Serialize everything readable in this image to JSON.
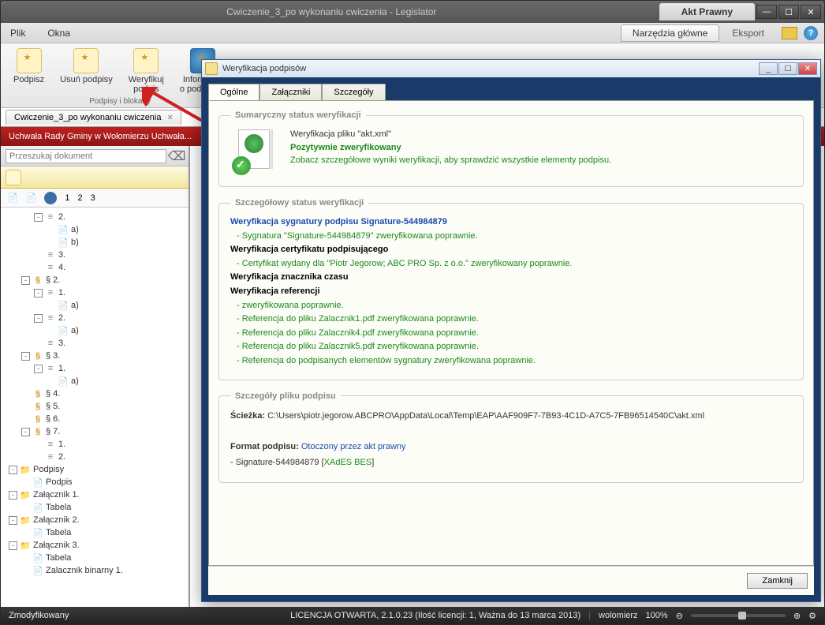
{
  "window": {
    "title_faded": "Cwiczenie_3_po wykonaniu cwiczenia - Legislator",
    "header_tab": "Akt Prawny"
  },
  "menubar": {
    "file": "Plik",
    "windows": "Okna",
    "tab_main": "Narzędzia główne",
    "tab_export": "Eksport"
  },
  "ribbon": {
    "sign": "Podpisz",
    "remove_sigs": "Usuń podpisy",
    "verify_sig_l1": "Weryfikuj",
    "verify_sig_l2": "podpis",
    "sig_info_l1": "Informacja",
    "sig_info_l2": "o podpisach",
    "group_label": "Podpisy i blokady"
  },
  "doc_tab": {
    "label": "Cwiczenie_3_po wykonaniu cwiczenia"
  },
  "red_bar": "Uchwała Rady Gminy w Wołomierzu Uchwała...",
  "search": {
    "placeholder": "Przeszukaj dokument"
  },
  "nav": {
    "n1": "1",
    "n2": "2",
    "n3": "3"
  },
  "tree": [
    {
      "indent": 2,
      "toggle": "-",
      "icon": "num",
      "label": "2."
    },
    {
      "indent": 3,
      "toggle": "",
      "icon": "file",
      "label": "a)"
    },
    {
      "indent": 3,
      "toggle": "",
      "icon": "file",
      "label": "b)"
    },
    {
      "indent": 2,
      "toggle": "",
      "icon": "num",
      "label": "3."
    },
    {
      "indent": 2,
      "toggle": "",
      "icon": "num",
      "label": "4."
    },
    {
      "indent": 1,
      "toggle": "-",
      "icon": "para",
      "label": "§ 2."
    },
    {
      "indent": 2,
      "toggle": "-",
      "icon": "num",
      "label": "1."
    },
    {
      "indent": 3,
      "toggle": "",
      "icon": "file",
      "label": "a)"
    },
    {
      "indent": 2,
      "toggle": "-",
      "icon": "num",
      "label": "2."
    },
    {
      "indent": 3,
      "toggle": "",
      "icon": "file",
      "label": "a)"
    },
    {
      "indent": 2,
      "toggle": "",
      "icon": "num",
      "label": "3."
    },
    {
      "indent": 1,
      "toggle": "-",
      "icon": "para",
      "label": "§ 3."
    },
    {
      "indent": 2,
      "toggle": "-",
      "icon": "num",
      "label": "1."
    },
    {
      "indent": 3,
      "toggle": "",
      "icon": "file",
      "label": "a)"
    },
    {
      "indent": 1,
      "toggle": "",
      "icon": "para",
      "label": "§ 4."
    },
    {
      "indent": 1,
      "toggle": "",
      "icon": "para",
      "label": "§ 5."
    },
    {
      "indent": 1,
      "toggle": "",
      "icon": "para",
      "label": "§ 6."
    },
    {
      "indent": 1,
      "toggle": "-",
      "icon": "para",
      "label": "§ 7."
    },
    {
      "indent": 2,
      "toggle": "",
      "icon": "num",
      "label": "1."
    },
    {
      "indent": 2,
      "toggle": "",
      "icon": "num",
      "label": "2."
    },
    {
      "indent": 0,
      "toggle": "-",
      "icon": "folder",
      "label": "Podpisy"
    },
    {
      "indent": 1,
      "toggle": "",
      "icon": "file",
      "label": "Podpis"
    },
    {
      "indent": 0,
      "toggle": "-",
      "icon": "folder",
      "label": "Załącznik 1."
    },
    {
      "indent": 1,
      "toggle": "",
      "icon": "file",
      "label": "Tabela"
    },
    {
      "indent": 0,
      "toggle": "-",
      "icon": "folder",
      "label": "Załącznik 2."
    },
    {
      "indent": 1,
      "toggle": "",
      "icon": "file",
      "label": "Tabela"
    },
    {
      "indent": 0,
      "toggle": "-",
      "icon": "folder",
      "label": "Załącznik 3."
    },
    {
      "indent": 1,
      "toggle": "",
      "icon": "file",
      "label": "Tabela"
    },
    {
      "indent": 1,
      "toggle": "",
      "icon": "file",
      "label": "Zalacznik binarny 1."
    }
  ],
  "dialog": {
    "title": "Weryfikacja podpisów",
    "tabs": {
      "general": "Ogólne",
      "attachments": "Załączniki",
      "details": "Szczegóły"
    },
    "summary": {
      "legend": "Sumaryczny status weryfikacji",
      "line1": "Weryfikacja pliku \"akt.xml\"",
      "line2": "Pozytywnie zweryfikowany",
      "line3": "Zobacz szczegółowe wyniki weryfikacji, aby sprawdzić wszystkie elementy podpisu."
    },
    "detailed": {
      "legend": "Szczegółowy status weryfikacji",
      "sig_hdr": "Weryfikacja sygnatury podpisu Signature-544984879",
      "sig_ok": "- Sygnatura \"Signature-544984879\" zweryfikowana poprawnie.",
      "cert_hdr": "Weryfikacja certyfikatu podpisującego",
      "cert_ok": "- Certyfikat wydany dla \"Piotr Jegorow; ABC PRO Sp. z o.o.\" zweryfikowany poprawnie.",
      "ts_hdr": "Weryfikacja znacznika czasu",
      "ref_hdr": "Weryfikacja referencji",
      "ref_ok1": " -  zweryfikowana poprawnie.",
      "ref_ok2": " - Referencja do pliku Zalacznik1.pdf zweryfikowana poprawnie.",
      "ref_ok3": " - Referencja do pliku Zalacznik4.pdf zweryfikowana poprawnie.",
      "ref_ok4": " - Referencja do pliku Zalacznik5.pdf zweryfikowana poprawnie.",
      "ref_ok5": " - Referencja do podpisanych elementów sygnatury zweryfikowana poprawnie."
    },
    "file": {
      "legend": "Szczegóły pliku podpisu",
      "path_label": "Ścieżka:",
      "path": "C:\\Users\\piotr.jegorow.ABCPRO\\AppData\\Local\\Temp\\EAP\\AAF909F7-7B93-4C1D-A7C5-7FB96514540C\\akt.xml",
      "format_label": "Format podpisu:",
      "format_value": "Otoczony przez akt prawny",
      "sig_line": " - Signature-544984879 [",
      "sig_type": "XAdES BES",
      "sig_line_end": "]"
    },
    "close_btn": "Zamknij"
  },
  "status": {
    "modified": "Zmodyfikowany",
    "license": "LICENCJA OTWARTA, 2.1.0.23 (Ilość licencji: 1, Ważna do 13 marca 2013)",
    "user": "wolomierz",
    "zoom": "100%"
  }
}
